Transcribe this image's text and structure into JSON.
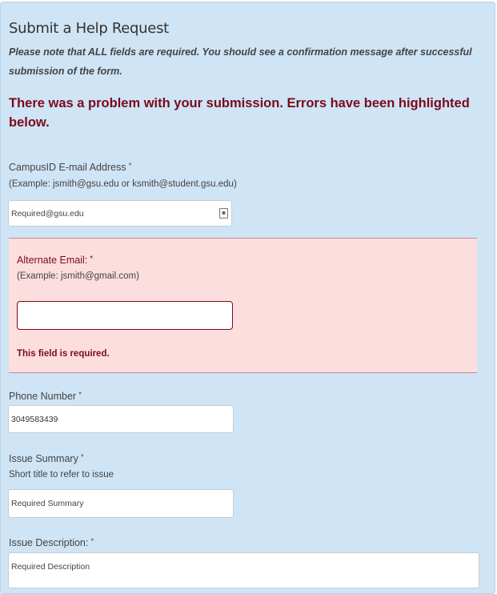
{
  "form": {
    "title": "Submit a Help Request",
    "note": "Please note that ALL fields are required. You should see a confirmation message after successful submission of the form.",
    "error_banner": "There was a problem with your submission. Errors have been highlighted below.",
    "required_mark": "*"
  },
  "fields": {
    "campus_email": {
      "label": "CampusID E-mail Address",
      "description": "(Example: jsmith@gsu.edu or ksmith@student.gsu.edu)",
      "placeholder": "Required@gsu.edu",
      "value": "",
      "icon": "contact-card-icon"
    },
    "alternate_email": {
      "label": "Alternate Email:",
      "description": "(Example: jsmith@gmail.com)",
      "value": "",
      "error": "This field is required."
    },
    "phone": {
      "label": "Phone Number",
      "value": "3049583439"
    },
    "issue_summary": {
      "label": "Issue Summary",
      "description": "Short title to refer to issue",
      "placeholder": "Required Summary",
      "value": ""
    },
    "issue_description": {
      "label": "Issue Description:",
      "placeholder": "Required Description",
      "value": ""
    }
  }
}
